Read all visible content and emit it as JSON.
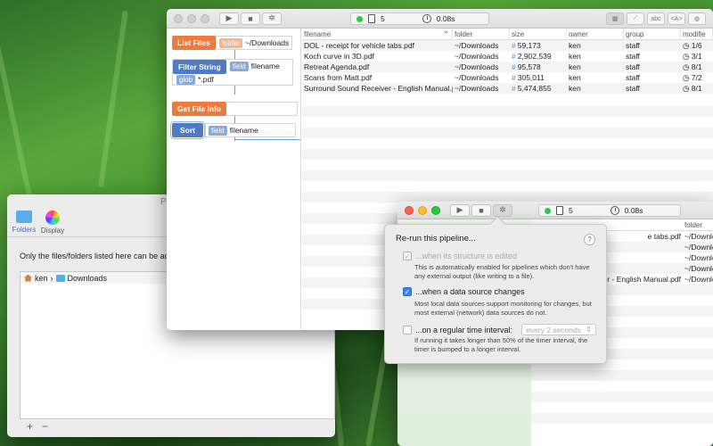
{
  "preferences": {
    "title": "Prefe",
    "tabs": [
      {
        "label": "Folders"
      },
      {
        "label": "Display"
      }
    ],
    "description": "Only the files/folders listed here can be acc",
    "path": {
      "home": "ken",
      "folder": "Downloads"
    },
    "add_button": "+",
    "remove_button": "−"
  },
  "main_window": {
    "status": {
      "count": "5",
      "time": "0.08s"
    },
    "view_buttons": [
      "",
      "",
      "abc",
      "<A>",
      ""
    ],
    "pipeline": [
      {
        "name": "List Files",
        "param_key": "folder",
        "param_value": "~/Downloads",
        "color": "orange"
      },
      {
        "name": "Filter String",
        "param_key": "field",
        "param_value": "filename",
        "param_key2": "glob",
        "param_value2": "*.pdf",
        "color": "blue"
      },
      {
        "name": "Get File Info",
        "color": "orange"
      },
      {
        "name": "Sort",
        "param_key": "field",
        "param_value": "filename",
        "color": "blue"
      }
    ],
    "table": {
      "columns": [
        "filename",
        "folder",
        "size",
        "owner",
        "group",
        "modifie"
      ],
      "rows": [
        {
          "filename": "DOL - receipt for vehicle tabs.pdf",
          "folder": "~/Downloads",
          "size": "59,173",
          "owner": "ken",
          "group": "staff",
          "modified": "1/6"
        },
        {
          "filename": "Koch curve in 3D.pdf",
          "folder": "~/Downloads",
          "size": "2,902,539",
          "owner": "ken",
          "group": "staff",
          "modified": "3/1"
        },
        {
          "filename": "Retreat Agenda.pdf",
          "folder": "~/Downloads",
          "size": "95,578",
          "owner": "ken",
          "group": "staff",
          "modified": "8/1"
        },
        {
          "filename": "Scans from Matt.pdf",
          "folder": "~/Downloads",
          "size": "305,011",
          "owner": "ken",
          "group": "staff",
          "modified": "7/2"
        },
        {
          "filename": "Surround Sound Receiver - English Manual.pdf",
          "folder": "~/Downloads",
          "size": "5,474,855",
          "owner": "ken",
          "group": "staff",
          "modified": "8/1"
        }
      ]
    }
  },
  "second_window": {
    "status": {
      "count": "5",
      "time": "0.08s"
    },
    "column_header": "folder",
    "rows": [
      {
        "filename": "e tabs.pdf",
        "folder": "~/Downlo"
      },
      {
        "filename": "",
        "folder": "~/Downlo"
      },
      {
        "filename": "",
        "folder": "~/Downlo"
      },
      {
        "filename": "",
        "folder": "~/Downlo"
      },
      {
        "filename": "er - English Manual.pdf",
        "folder": "~/Downlo"
      }
    ]
  },
  "popover": {
    "title": "Re-run this pipeline...",
    "help": "?",
    "options": [
      {
        "label": "...when its structure is edited",
        "checked": true,
        "disabled": true,
        "description": "This is automatically enabled for pipelines which don't have any external output (like writing to a file)."
      },
      {
        "label": "...when a data source changes",
        "checked": true,
        "disabled": false,
        "description": "Most local data sources support monitoring for changes, but most external (network) data sources do not."
      },
      {
        "label": "...on a regular time interval:",
        "checked": false,
        "disabled": false,
        "select_value": "every 2 seconds",
        "description": "If running it takes longer than 50% of the timer interval, the timer is bumped to a longer interval."
      }
    ]
  }
}
